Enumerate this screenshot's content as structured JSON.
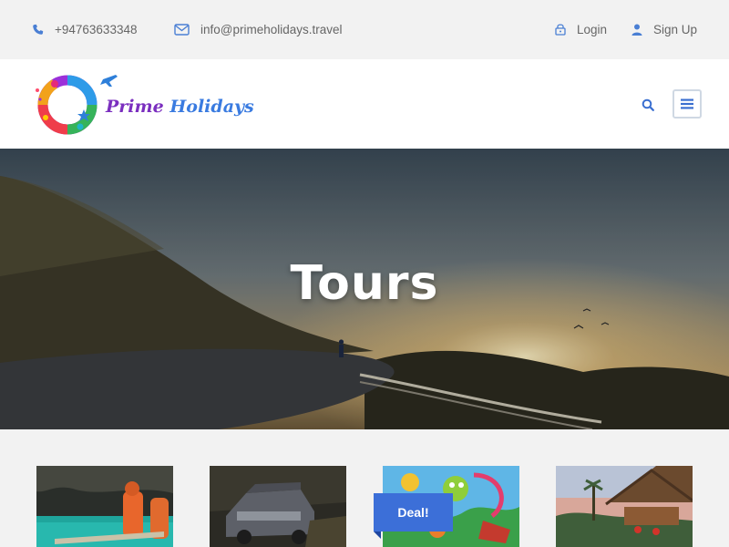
{
  "topbar": {
    "phone": "+94763633348",
    "email": "info@primeholidays.travel",
    "login_label": "Login",
    "signup_label": "Sign Up"
  },
  "brand": {
    "name_part1": "Prime",
    "name_part2": "Holidays",
    "primary_color": "#7b2fbf",
    "accent_color": "#3a7be0"
  },
  "hero": {
    "title": "Tours"
  },
  "cards": {
    "deal_badge": "Deal!"
  },
  "icons": {
    "phone": "phone-icon",
    "email": "envelope-icon",
    "login": "lock-icon",
    "signup": "user-icon",
    "search": "search-icon",
    "menu": "hamburger-menu-icon"
  }
}
